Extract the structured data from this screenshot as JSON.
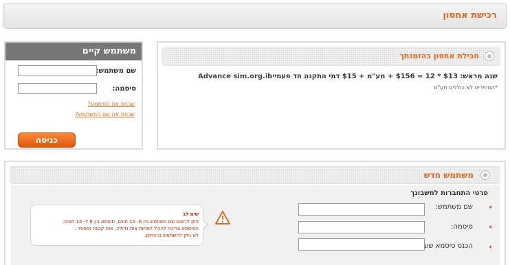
{
  "page": {
    "title": "רכישת אחסון"
  },
  "login": {
    "title": "משתמש קיים",
    "username_label": "שם משתמש:",
    "password_label": "סיסמה:",
    "forgot_password": "שכחת את הסיסמא?",
    "forgot_username": "שכחת את שם המשתמש?",
    "submit": "כניסה"
  },
  "plan": {
    "title": "חבילת אחסון בהזמנתך",
    "description": "שנה מראש: $13 * 12 = $156 + מע\"מ + $15 דמי התקנה חד פעמיים",
    "note": "*המחירים לא כוללים מע\"מ",
    "site": "Advance sim.org.il"
  },
  "new_user": {
    "title": "משתמש חדש",
    "subtitle": "פרטי התחברות לחשבונך",
    "fields": [
      {
        "label": "שם משתמש:",
        "required_mark": "*"
      },
      {
        "label": "סיסמה:",
        "required_mark": "*"
      },
      {
        "label": "הכנס סיסמא שוב:",
        "required_mark": "*"
      }
    ],
    "notice": {
      "title": "שים לב",
      "lines": [
        "ניתן לרשום שם משתמש בין 6- 15 תווים, סיסמא בין 8 ל- 15 תווים.",
        "הסיסמא צריכה להכיל למחות אות גדולה, אות קטנה ומספר.",
        "לא ניתן להשתמש ברווחים."
      ]
    }
  },
  "colors": {
    "accent": "#e06a1e",
    "warning": "#cc2200"
  }
}
